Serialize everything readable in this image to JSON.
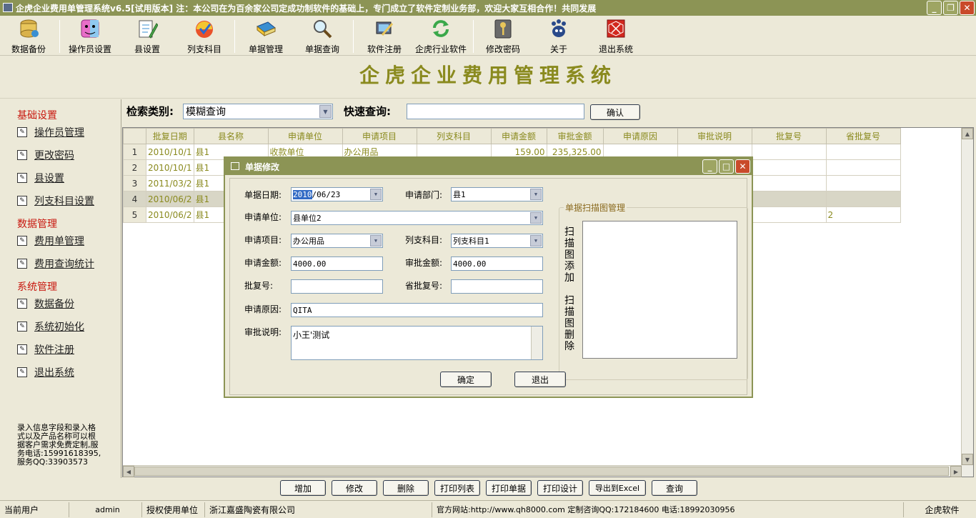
{
  "window": {
    "title": "企虎企业费用单管理系统v6.5[试用版本]  注：本公司在为百余家公司定成功制软件的基础上，专门成立了软件定制业务部，欢迎大家互相合作！共同发展"
  },
  "toolbar": {
    "items": [
      {
        "label": "数据备份",
        "icon": "database-icon"
      },
      {
        "label": "操作员设置",
        "icon": "finder-face-icon"
      },
      {
        "label": "县设置",
        "icon": "pencil-paper-icon"
      },
      {
        "label": "列支科目",
        "icon": "checkmark-ball-icon"
      },
      {
        "label": "单据管理",
        "icon": "book-pencil-icon"
      },
      {
        "label": "单据查询",
        "icon": "magnifier-icon"
      },
      {
        "label": "软件注册",
        "icon": "register-icon"
      },
      {
        "label": "企虎行业软件",
        "icon": "refresh-arrows-icon"
      },
      {
        "label": "修改密码",
        "icon": "key-icon"
      },
      {
        "label": "关于",
        "icon": "pawprint-icon"
      },
      {
        "label": "退出系统",
        "icon": "exit-cube-icon"
      }
    ]
  },
  "banner": {
    "title": "企虎企业费用管理系统"
  },
  "sidebar": {
    "groups": [
      {
        "title": "基础设置",
        "items": [
          "操作员管理",
          "更改密码",
          "县设置",
          "列支科目设置"
        ]
      },
      {
        "title": "数据管理",
        "items": [
          "费用单管理",
          "费用查询统计"
        ]
      },
      {
        "title": "系统管理",
        "items": [
          "数据备份",
          "系统初始化",
          "软件注册",
          "退出系统"
        ]
      }
    ],
    "note": "录入信息字段和录入格式以及产品名称可以根据客户需求免费定制,服务电话:15991618395,服务QQ:33903573"
  },
  "search": {
    "category_label": "检索类别:",
    "category_value": "模糊查询",
    "quick_label": "快速查询:",
    "quick_value": "",
    "confirm_label": "确认"
  },
  "grid": {
    "columns": [
      "批复日期",
      "县名称",
      "申请单位",
      "申请项目",
      "列支科目",
      "申请金额",
      "审批金额",
      "申请原因",
      "审批说明",
      "批复号",
      "省批复号"
    ],
    "rows": [
      {
        "n": "1",
        "date": "2010/10/1",
        "county": "县1",
        "unit": "收款单位",
        "item": "办公用品",
        "subject": "",
        "amount": "159.00",
        "approved": "235,325.00",
        "reason": "",
        "desc": "",
        "no": "",
        "prov": ""
      },
      {
        "n": "2",
        "date": "2010/10/1",
        "county": "县1",
        "unit": "",
        "item": "",
        "subject": "",
        "amount": "",
        "approved": "",
        "reason": "",
        "desc": "",
        "no": "",
        "prov": ""
      },
      {
        "n": "3",
        "date": "2011/03/2",
        "county": "县1",
        "unit": "",
        "item": "",
        "subject": "",
        "amount": "",
        "approved": "",
        "reason": "",
        "desc": "",
        "no": "",
        "prov": ""
      },
      {
        "n": "4",
        "date": "2010/06/2",
        "county": "县1",
        "unit": "",
        "item": "",
        "subject": "",
        "amount": "",
        "approved": "",
        "reason": "",
        "desc": "",
        "no": "",
        "prov": ""
      },
      {
        "n": "5",
        "date": "2010/06/2",
        "county": "县1",
        "unit": "",
        "item": "",
        "subject": "",
        "amount": "",
        "approved": "",
        "reason": "",
        "desc": "",
        "no": "",
        "prov": "2"
      }
    ]
  },
  "actions": [
    "增加",
    "修改",
    "删除",
    "打印列表",
    "打印单据",
    "打印设计",
    "导出到Excel",
    "查询"
  ],
  "status": {
    "user_label": "当前用户",
    "user": "admin",
    "auth_label": "授权使用单位",
    "company": "浙江嘉盛陶瓷有限公司",
    "site": "官方网站:http://www.qh8000.com 定制咨询QQ:172184600 电话:18992030956",
    "brand": "企虎软件"
  },
  "dialog": {
    "title": "单据修改",
    "date_label": "单据日期:",
    "date_sel": "2010",
    "date_rest": "/06/23",
    "dept_label": "申请部门:",
    "dept_value": "县1",
    "unit_label": "申请单位:",
    "unit_value": "县单位2",
    "item_label": "申请项目:",
    "item_value": "办公用品",
    "subject_label": "列支科目:",
    "subject_value": "列支科目1",
    "amount_label": "申请金额:",
    "amount_value": "4000.00",
    "approved_label": "审批金额:",
    "approved_value": "4000.00",
    "no_label": "批复号:",
    "no_value": "",
    "prov_label": "省批复号:",
    "prov_value": "",
    "reason_label": "申请原因:",
    "reason_value": "QITA",
    "desc_label": "审批说明:",
    "desc_value": "小王'测试",
    "scan_group": "单据扫描图管理",
    "scan_add": "扫描图添加",
    "scan_delete": "扫描图删除",
    "ok_label": "确定",
    "exit_label": "退出"
  }
}
